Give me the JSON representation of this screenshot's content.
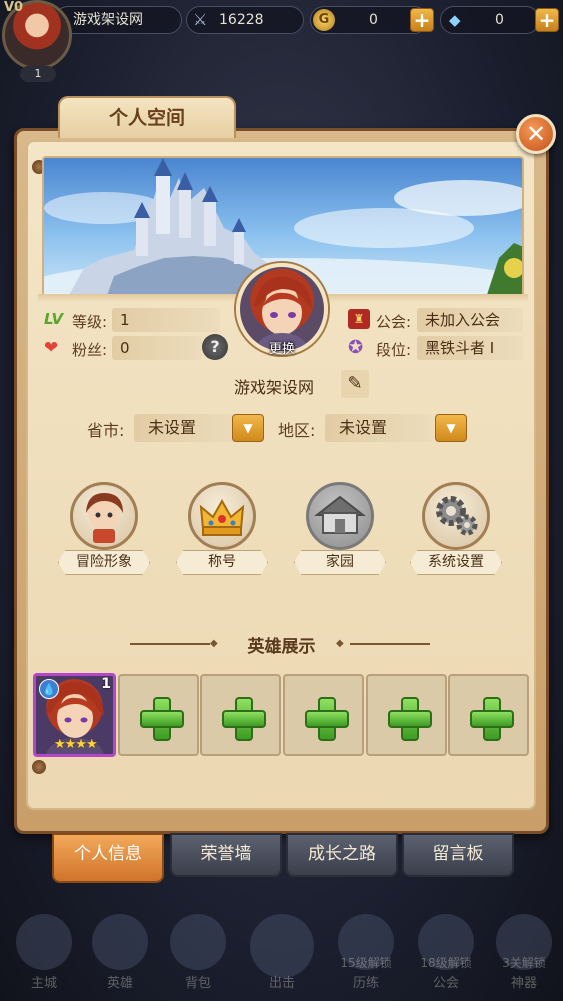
{
  "topbar": {
    "vip": "V0",
    "player_level": "1",
    "player_name": "游戏架设网",
    "power": "16228",
    "gold": "0",
    "diamonds": "0"
  },
  "panel": {
    "title": "个人空间",
    "close_symbol": "✕"
  },
  "profile": {
    "level_label": "等级:",
    "level_value": "1",
    "fans_label": "粉丝:",
    "fans_value": "0",
    "guild_label": "公会:",
    "guild_value": "未加入公会",
    "rank_label": "段位:",
    "rank_value": "黑铁斗者 I",
    "change_label": "更换",
    "name": "游戏架设网"
  },
  "location": {
    "province_label": "省市:",
    "province_value": "未设置",
    "region_label": "地区:",
    "region_value": "未设置"
  },
  "menu": [
    {
      "label": "冒险形象",
      "icon": "adventurer-icon"
    },
    {
      "label": "称号",
      "icon": "crown-icon"
    },
    {
      "label": "家园",
      "icon": "house-icon"
    },
    {
      "label": "系统设置",
      "icon": "gears-icon"
    }
  ],
  "hero_display": {
    "title": "英雄展示",
    "slot1_level": "1",
    "slot1_stars": "★★★★"
  },
  "tabs": [
    "个人信息",
    "荣誉墙",
    "成长之路",
    "留言板"
  ],
  "nav": [
    {
      "label": "主城",
      "sub": ""
    },
    {
      "label": "英雄",
      "sub": ""
    },
    {
      "label": "背包",
      "sub": ""
    },
    {
      "label": "出击",
      "sub": ""
    },
    {
      "label": "历练",
      "sub": "15级解锁"
    },
    {
      "label": "公会",
      "sub": "18级解锁"
    },
    {
      "label": "神器",
      "sub": "3关解锁"
    }
  ],
  "colors": {
    "accent_orange": "#d0742a",
    "parchment": "#f3e5c6",
    "plus_green": "#3e9c24",
    "hero_frame_purple": "#b446c9"
  }
}
